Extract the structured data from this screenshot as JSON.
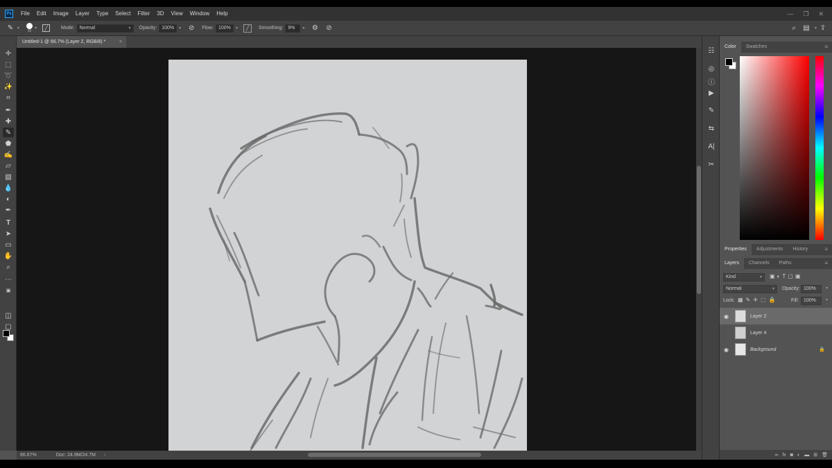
{
  "app": {
    "logo": "Ps",
    "menu": [
      "File",
      "Edit",
      "Image",
      "Layer",
      "Type",
      "Select",
      "Filter",
      "3D",
      "View",
      "Window",
      "Help"
    ]
  },
  "window_controls": {
    "minimize": "—",
    "restore": "❐",
    "close": "✕"
  },
  "options": {
    "brush_size": "30",
    "mode_label": "Mode:",
    "mode_value": "Normal",
    "opacity_label": "Opacity:",
    "opacity_value": "100%",
    "flow_label": "Flow:",
    "flow_value": "100%",
    "smoothing_label": "Smoothing:",
    "smoothing_value": "9%"
  },
  "document_tab": {
    "title": "Untitled-1 @ 66.7% (Layer 2, RGB/8) *",
    "close": "×"
  },
  "status": {
    "zoom": "66.67%",
    "doc": "Doc: 24.9M/24.7M",
    "arrow": "›"
  },
  "color_panel": {
    "tabs": [
      "Color",
      "Swatches"
    ],
    "foreground": "#000000",
    "background": "#ffffff"
  },
  "properties_tabs": [
    "Properties",
    "Adjustments",
    "History"
  ],
  "layers_panel": {
    "tabs": [
      "Layers",
      "Channels",
      "Paths"
    ],
    "filter_label": "Kind",
    "blend_mode": "Normal",
    "opacity_label": "Opacity:",
    "opacity_value": "100%",
    "lock_label": "Lock:",
    "fill_label": "Fill:",
    "fill_value": "100%",
    "layers": [
      {
        "name": "Layer 2",
        "visible": true,
        "selected": true
      },
      {
        "name": "Layer 4",
        "visible": false,
        "selected": false
      },
      {
        "name": "Background",
        "visible": true,
        "selected": false,
        "locked": true
      }
    ],
    "footer_icons": [
      "link-icon",
      "fx-icon",
      "mask-icon",
      "adjustment-icon",
      "group-icon",
      "new-layer-icon",
      "trash-icon"
    ]
  },
  "colors": {
    "canvas": "#d2d3d5",
    "workspace": "#161616",
    "panel": "#535353",
    "stroke": "#6b6b6b"
  }
}
